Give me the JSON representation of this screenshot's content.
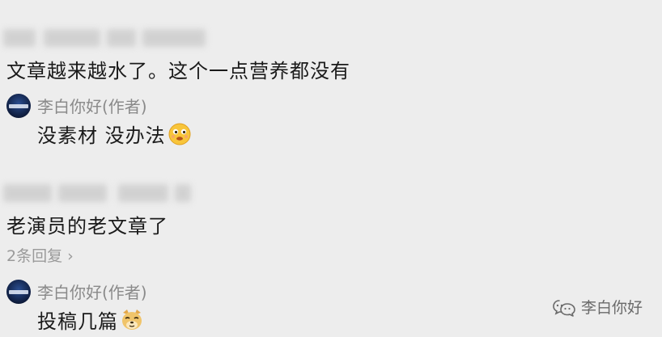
{
  "comments": [
    {
      "text": "文章越来越水了。这个一点营养都没有",
      "reply": {
        "author": "李白你好(作者)",
        "text": "没素材 没办法",
        "emoji": "smiling-face-icon"
      }
    },
    {
      "text": "老演员的老文章了",
      "more_replies": "2条回复",
      "reply": {
        "author": "李白你好(作者)",
        "text": "投稿几篇",
        "emoji": "doge-icon"
      }
    }
  ],
  "watermark": {
    "name": "李白你好",
    "icon": "wechat-channel-icon"
  },
  "colors": {
    "background": "#ededed",
    "text": "#1a1a1a",
    "muted": "#8a8a8a"
  }
}
